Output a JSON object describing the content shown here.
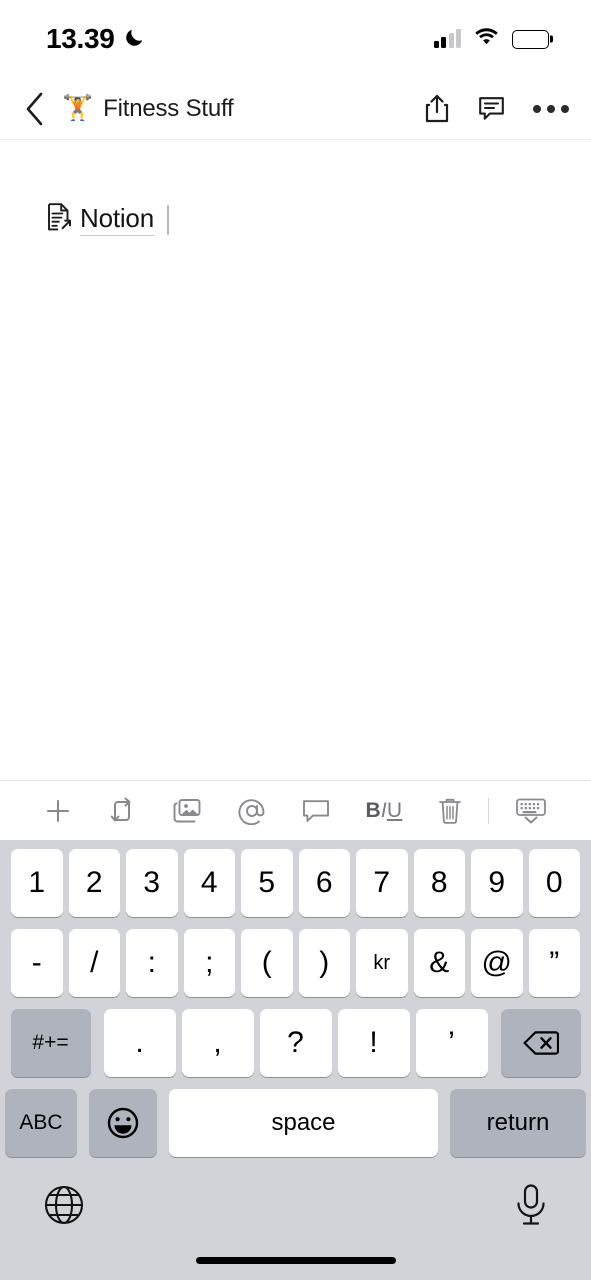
{
  "status_bar": {
    "time": "13.39",
    "dnd_icon": "moon-icon",
    "signal_icon": "cellular-signal-icon",
    "wifi_icon": "wifi-icon",
    "battery_icon": "battery-full-icon"
  },
  "nav_bar": {
    "back_icon": "chevron-left-icon",
    "page_emoji": "🏋️",
    "title": "Fitness Stuff",
    "share_icon": "share-icon",
    "comment_icon": "comment-icon",
    "more_icon": "more-horizontal-icon"
  },
  "content": {
    "link_icon": "document-link-icon",
    "link_text": "Notion",
    "caret": "text-cursor"
  },
  "toolbar": {
    "items": [
      {
        "name": "add-block-button",
        "icon": "plus-icon"
      },
      {
        "name": "move-block-button",
        "icon": "indent-arrows-icon"
      },
      {
        "name": "insert-image-button",
        "icon": "photos-icon"
      },
      {
        "name": "mention-button",
        "icon": "at-mention-icon"
      },
      {
        "name": "comment-button",
        "icon": "comment-bubble-icon"
      },
      {
        "name": "text-format-button",
        "icon": "biu-icon"
      },
      {
        "name": "delete-block-button",
        "icon": "trash-icon"
      },
      {
        "name": "dismiss-keyboard-button",
        "icon": "keyboard-dismiss-icon"
      }
    ],
    "biu": {
      "bold": "B",
      "italic": "I",
      "underline": "U"
    }
  },
  "keyboard": {
    "row1": [
      "1",
      "2",
      "3",
      "4",
      "5",
      "6",
      "7",
      "8",
      "9",
      "0"
    ],
    "row2": [
      "-",
      "/",
      ":",
      ";",
      "(",
      ")",
      "kr",
      "&",
      "@",
      "”"
    ],
    "row3": {
      "symbols_key": "#+=",
      "keys": [
        ".",
        ",",
        "?",
        "!",
        "’"
      ],
      "backspace_icon": "backspace-icon"
    },
    "row4": {
      "abc_key": "ABC",
      "emoji_icon": "emoji-smiley-icon",
      "space_key": "space",
      "return_key": "return"
    },
    "bottom": {
      "globe_icon": "globe-icon",
      "mic_icon": "microphone-icon",
      "home_indicator": "home-indicator"
    }
  },
  "colors": {
    "keyboard_bg": "#d1d3d9",
    "key_light": "#ffffff",
    "key_dark": "#aeb3be",
    "toolbar_icon": "#8a8a8e",
    "text_primary": "#141414"
  }
}
